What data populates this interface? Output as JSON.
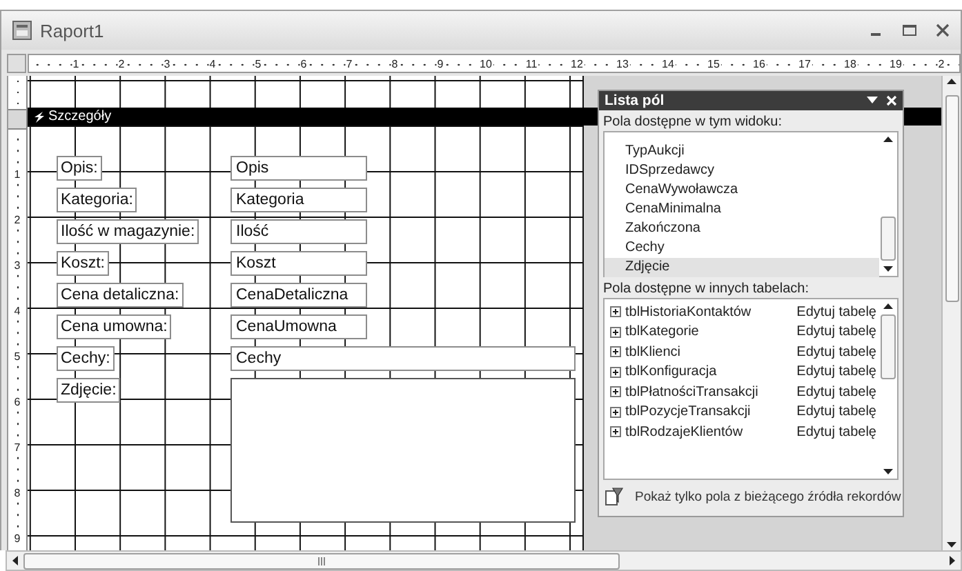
{
  "window": {
    "title": "Raport1"
  },
  "ruler": {
    "marks": [
      "1",
      "2",
      "3",
      "4",
      "5",
      "6",
      "7",
      "8",
      "9",
      "10",
      "11",
      "12",
      "13",
      "14",
      "15",
      "16",
      "17",
      "18",
      "19",
      "2"
    ]
  },
  "vertical_ruler": {
    "marks": [
      "1",
      "2",
      "3",
      "4",
      "5",
      "6",
      "7",
      "8",
      "9"
    ]
  },
  "section": {
    "title": "Szczegóły"
  },
  "controls": [
    {
      "kind": "text",
      "label": "Opis:",
      "field": "Opis"
    },
    {
      "kind": "text",
      "label": "Kategoria:",
      "field": "Kategoria"
    },
    {
      "kind": "text",
      "label": "Ilość w magazynie:",
      "field": "Ilość"
    },
    {
      "kind": "text",
      "label": "Koszt:",
      "field": "Koszt"
    },
    {
      "kind": "text",
      "label": "Cena detaliczna:",
      "field": "CenaDetaliczna"
    },
    {
      "kind": "text",
      "label": "Cena umowna:",
      "field": "CenaUmowna"
    },
    {
      "kind": "wide",
      "label": "Cechy:",
      "field": "Cechy"
    },
    {
      "kind": "image",
      "label": "Zdjęcie:"
    }
  ],
  "field_list": {
    "title": "Lista pól",
    "current_heading": "Pola dostępne w tym widoku:",
    "fields": [
      {
        "name": "TypAukcji",
        "selected": false
      },
      {
        "name": "IDSprzedawcy",
        "selected": false
      },
      {
        "name": "CenaWywoławcza",
        "selected": false
      },
      {
        "name": "CenaMinimalna",
        "selected": false
      },
      {
        "name": "Zakończona",
        "selected": false
      },
      {
        "name": "Cechy",
        "selected": false
      },
      {
        "name": "Zdjęcie",
        "selected": true
      }
    ],
    "other_heading": "Pola dostępne w innych tabelach:",
    "tables": [
      {
        "name": "tblHistoriaKontaktów",
        "action": "Edytuj tabelę"
      },
      {
        "name": "tblKategorie",
        "action": "Edytuj tabelę"
      },
      {
        "name": "tblKlienci",
        "action": "Edytuj tabelę"
      },
      {
        "name": "tblKonfiguracja",
        "action": "Edytuj tabelę"
      },
      {
        "name": "tblPłatnościTransakcji",
        "action": "Edytuj tabelę"
      },
      {
        "name": "tblPozycjeTransakcji",
        "action": "Edytuj tabelę"
      },
      {
        "name": "tblRodzajeKlientów",
        "action": "Edytuj tabelę"
      }
    ],
    "footer": "Pokaż tylko pola z bieżącego źródła rekordów"
  }
}
